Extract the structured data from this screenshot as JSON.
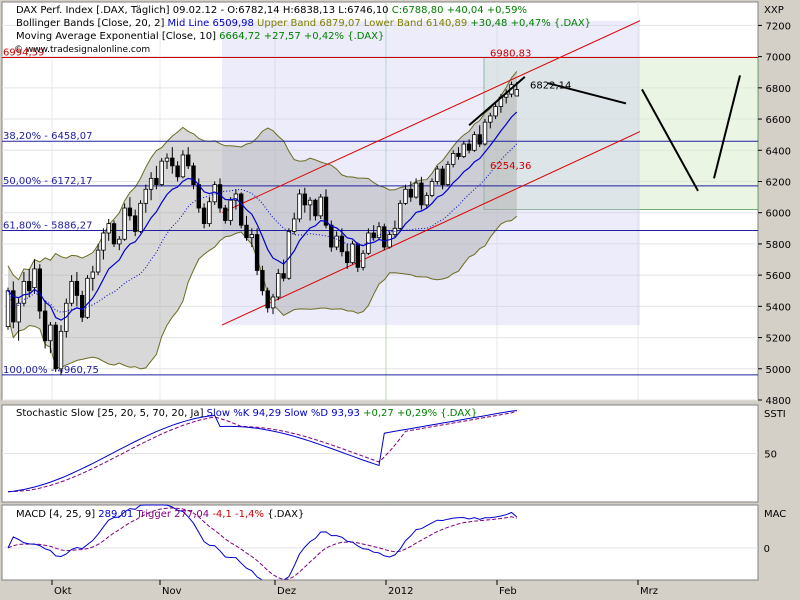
{
  "header": {
    "main": [
      {
        "text": "DAX Perf. Index [.DAX, Täglich] 09.02.12 - O:6782,14 H:6838,13 L:6746,10",
        "color": "#000000"
      },
      {
        "text": "C:6788,80 +40,04 +0,59%",
        "color": "#008000"
      }
    ],
    "bollinger": [
      {
        "text": "Bollinger Bands [Close, 20, 2]",
        "color": "#000000"
      },
      {
        "text": "Mid Line 6509,98",
        "color": "#0000cc"
      },
      {
        "text": "Upper Band 6879,07",
        "color": "#808000"
      },
      {
        "text": "Lower Band 6140,89",
        "color": "#808000"
      },
      {
        "text": "+30,48 +0,47% {.DAX}",
        "color": "#008000"
      }
    ],
    "ema": [
      {
        "text": "Moving Average Exponential [Close, 10]",
        "color": "#000000"
      },
      {
        "text": "6664,72 +27,57 +0,42% {.DAX}",
        "color": "#008000"
      }
    ],
    "copyright": "© www.tradesignalonline.com"
  },
  "stoch_header": [
    {
      "text": "Stochastic Slow [25, 20, 5, 70, 20, Ja]",
      "color": "#000000"
    },
    {
      "text": "Slow %K 94,29",
      "color": "#0000cc"
    },
    {
      "text": "Slow %D 93,93",
      "color": "#0000cc"
    },
    {
      "text": "+0,27 +0,29% {.DAX}",
      "color": "#008000"
    }
  ],
  "macd_header": [
    {
      "text": "MACD [4, 25, 9]",
      "color": "#000000"
    },
    {
      "text": "289,01",
      "color": "#0000cc"
    },
    {
      "text": "Trigger 277,04",
      "color": "#800080"
    },
    {
      "text": "-4,1 -1,4%",
      "color": "#cc0000"
    },
    {
      "text": "{.DAX}",
      "color": "#000000"
    }
  ],
  "axis_labels": {
    "main": "XXP",
    "stoch": "SSTI",
    "macd": "MAC"
  },
  "chart_data": {
    "type": "candlestick",
    "instrument": "DAX Perf. Index",
    "ylim": [
      4800,
      7350
    ],
    "y_ticks": [
      4800,
      5000,
      5200,
      5400,
      5600,
      5800,
      6000,
      6200,
      6400,
      6600,
      6800,
      7000,
      7200
    ],
    "x_labels": [
      "Okt",
      "Nov",
      "Dez",
      "2012",
      "Feb",
      "Mrz"
    ],
    "fib_levels": [
      {
        "label": "38,20% - 6458,07",
        "value": 6458.07
      },
      {
        "label": "50,00% - 6172,17",
        "value": 6172.17
      },
      {
        "label": "61,80% - 5886,27",
        "value": 5886.27
      },
      {
        "label": "100,00% - 4960,75",
        "value": 4960.75
      },
      {
        "label": "6994,59",
        "value": 6994.59
      }
    ],
    "price_labels": [
      {
        "label": "6980,83",
        "value": 6980.83,
        "color": "#cc0000"
      },
      {
        "label": "6254,36",
        "value": 6254.36,
        "color": "#cc0000"
      },
      {
        "label": "6822,14",
        "value": 6822.14,
        "color": "#000000"
      }
    ],
    "last_close": 6788.8,
    "stoch": {
      "ylim": [
        0,
        100
      ],
      "ticks": [
        50
      ],
      "k_last": 94.29,
      "d_last": 93.93
    },
    "macd": {
      "ticks": [
        0
      ],
      "macd_last": 289.01,
      "trigger_last": 277.04
    },
    "candles": [
      [
        5270,
        5520,
        5250,
        5500
      ],
      [
        5500,
        5560,
        5260,
        5300
      ],
      [
        5300,
        5450,
        5180,
        5420
      ],
      [
        5420,
        5620,
        5400,
        5560
      ],
      [
        5560,
        5640,
        5460,
        5500
      ],
      [
        5520,
        5700,
        5480,
        5640
      ],
      [
        5640,
        5670,
        5320,
        5370
      ],
      [
        5370,
        5440,
        5130,
        5180
      ],
      [
        5180,
        5300,
        5100,
        5280
      ],
      [
        5280,
        5300,
        4980,
        5000
      ],
      [
        5000,
        5280,
        4960,
        5240
      ],
      [
        5240,
        5450,
        5200,
        5420
      ],
      [
        5420,
        5600,
        5400,
        5560
      ],
      [
        5560,
        5620,
        5400,
        5470
      ],
      [
        5470,
        5500,
        5300,
        5330
      ],
      [
        5330,
        5600,
        5320,
        5580
      ],
      [
        5580,
        5660,
        5500,
        5620
      ],
      [
        5620,
        5800,
        5600,
        5760
      ],
      [
        5760,
        5900,
        5700,
        5870
      ],
      [
        5870,
        5960,
        5820,
        5930
      ],
      [
        5930,
        5950,
        5780,
        5800
      ],
      [
        5800,
        5850,
        5760,
        5830
      ],
      [
        5830,
        6060,
        5820,
        6030
      ],
      [
        6030,
        6100,
        5950,
        5980
      ],
      [
        5980,
        6020,
        5850,
        5880
      ],
      [
        5880,
        6080,
        5870,
        6060
      ],
      [
        6060,
        6180,
        6000,
        6150
      ],
      [
        6150,
        6260,
        6080,
        6220
      ],
      [
        6220,
        6300,
        6150,
        6180
      ],
      [
        6180,
        6350,
        6170,
        6330
      ],
      [
        6330,
        6380,
        6280,
        6350
      ],
      [
        6350,
        6420,
        6250,
        6300
      ],
      [
        6300,
        6330,
        6200,
        6230
      ],
      [
        6230,
        6400,
        6220,
        6370
      ],
      [
        6370,
        6420,
        6280,
        6300
      ],
      [
        6300,
        6320,
        6150,
        6180
      ],
      [
        6180,
        6220,
        6000,
        6030
      ],
      [
        6030,
        6060,
        5900,
        5930
      ],
      [
        5930,
        6100,
        5910,
        6070
      ],
      [
        6070,
        6200,
        6050,
        6180
      ],
      [
        6180,
        6220,
        6000,
        6030
      ],
      [
        6030,
        6050,
        5930,
        5950
      ],
      [
        5950,
        6100,
        5920,
        6080
      ],
      [
        6080,
        6150,
        6020,
        6120
      ],
      [
        6120,
        6130,
        5900,
        5920
      ],
      [
        5920,
        5980,
        5820,
        5840
      ],
      [
        5840,
        5900,
        5780,
        5860
      ],
      [
        5860,
        5900,
        5600,
        5630
      ],
      [
        5630,
        5660,
        5470,
        5500
      ],
      [
        5500,
        5520,
        5360,
        5390
      ],
      [
        5390,
        5480,
        5350,
        5460
      ],
      [
        5460,
        5640,
        5440,
        5610
      ],
      [
        5610,
        5700,
        5560,
        5580
      ],
      [
        5580,
        5900,
        5570,
        5880
      ],
      [
        5880,
        6000,
        5860,
        5960
      ],
      [
        5960,
        6150,
        5940,
        6120
      ],
      [
        6120,
        6160,
        6000,
        6050
      ],
      [
        6050,
        6100,
        5950,
        6080
      ],
      [
        6080,
        6090,
        5950,
        5980
      ],
      [
        5980,
        6120,
        5960,
        6100
      ],
      [
        6100,
        6150,
        5900,
        5920
      ],
      [
        5920,
        5950,
        5750,
        5780
      ],
      [
        5780,
        5880,
        5760,
        5850
      ],
      [
        5850,
        5900,
        5720,
        5750
      ],
      [
        5750,
        5800,
        5640,
        5680
      ],
      [
        5680,
        5820,
        5670,
        5800
      ],
      [
        5800,
        5810,
        5620,
        5650
      ],
      [
        5650,
        5760,
        5630,
        5740
      ],
      [
        5740,
        5900,
        5730,
        5870
      ],
      [
        5870,
        5920,
        5820,
        5840
      ],
      [
        5840,
        5940,
        5830,
        5910
      ],
      [
        5910,
        5930,
        5760,
        5780
      ],
      [
        5780,
        5880,
        5770,
        5860
      ],
      [
        5860,
        5950,
        5840,
        5900
      ],
      [
        5900,
        6080,
        5890,
        6060
      ],
      [
        6060,
        6180,
        6050,
        6150
      ],
      [
        6150,
        6200,
        6070,
        6100
      ],
      [
        6100,
        6220,
        6090,
        6190
      ],
      [
        6190,
        6230,
        6020,
        6050
      ],
      [
        6050,
        6130,
        6030,
        6110
      ],
      [
        6110,
        6220,
        6100,
        6200
      ],
      [
        6200,
        6300,
        6180,
        6280
      ],
      [
        6280,
        6300,
        6150,
        6180
      ],
      [
        6180,
        6330,
        6170,
        6310
      ],
      [
        6310,
        6400,
        6290,
        6380
      ],
      [
        6380,
        6420,
        6340,
        6360
      ],
      [
        6360,
        6460,
        6350,
        6440
      ],
      [
        6440,
        6470,
        6380,
        6400
      ],
      [
        6400,
        6520,
        6390,
        6500
      ],
      [
        6500,
        6560,
        6420,
        6440
      ],
      [
        6440,
        6600,
        6430,
        6580
      ],
      [
        6580,
        6640,
        6540,
        6620
      ],
      [
        6620,
        6700,
        6600,
        6680
      ],
      [
        6680,
        6760,
        6640,
        6740
      ],
      [
        6740,
        6790,
        6700,
        6760
      ],
      [
        6760,
        6840,
        6740,
        6820
      ],
      [
        6748,
        6838,
        6746,
        6789
      ]
    ],
    "forecast_path": [
      [
        6830,
        6700
      ],
      [
        6790,
        6140
      ],
      [
        6220,
        6880
      ],
      [
        6840,
        6560
      ]
    ]
  }
}
